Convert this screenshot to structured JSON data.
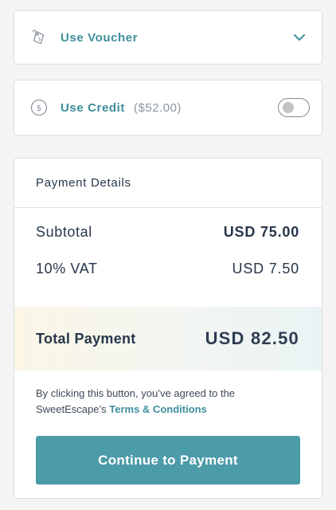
{
  "voucher": {
    "label": "Use Voucher",
    "icon": "tag-icon",
    "chevron": "chevron-down-icon"
  },
  "credit": {
    "label": "Use Credit",
    "amount": "($52.00)",
    "icon": "dollar-circle-icon",
    "toggle_on": false
  },
  "payment_details": {
    "title": "Payment Details",
    "subtotal_label": "Subtotal",
    "subtotal_value": "USD 75.00",
    "vat_label": "10% VAT",
    "vat_value": "USD 7.50",
    "total_label": "Total Payment",
    "total_value": "USD 82.50"
  },
  "agreement": {
    "text": "By clicking this button, you’ve agreed to the SweetEscape’s ",
    "link": "Terms & Conditions"
  },
  "cta": {
    "label": "Continue to Payment"
  },
  "colors": {
    "accent": "#3d8f9c",
    "button": "#4c9ba8",
    "text": "#27364a",
    "muted": "#8e97a3"
  }
}
